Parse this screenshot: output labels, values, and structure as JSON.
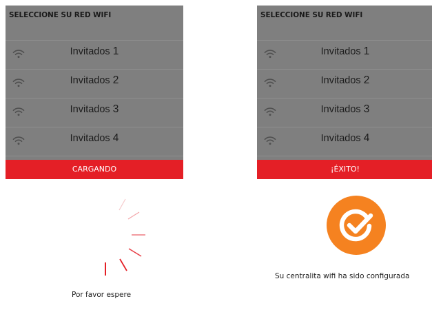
{
  "left_panel": {
    "header": "SELECCIONE SU RED WIFI",
    "networks": [
      {
        "label": "Invitados ",
        "num": "1"
      },
      {
        "label": "Invitados ",
        "num": "2"
      },
      {
        "label": "Invitados ",
        "num": "3"
      },
      {
        "label": "Invitados ",
        "num": "4"
      }
    ],
    "status": "CARGANDO",
    "caption": "Por favor espere"
  },
  "right_panel": {
    "header": "SELECCIONE SU RED WIFI",
    "networks": [
      {
        "label": "Invitados ",
        "num": "1"
      },
      {
        "label": "Invitados ",
        "num": "2"
      },
      {
        "label": "Invitados ",
        "num": "3"
      },
      {
        "label": "Invitados ",
        "num": "4"
      }
    ],
    "status": "¡ÉXITO!",
    "caption": "Su centralita wifi ha sido configurada"
  },
  "icons": {
    "wifi": "wifi-icon",
    "spinner": "loading-spinner-icon",
    "success": "check-circle-icon"
  },
  "colors": {
    "overlay": "#7f7f7f",
    "status_bar": "#e41f26",
    "success_badge": "#f58220",
    "spinner": "#e41f26"
  }
}
